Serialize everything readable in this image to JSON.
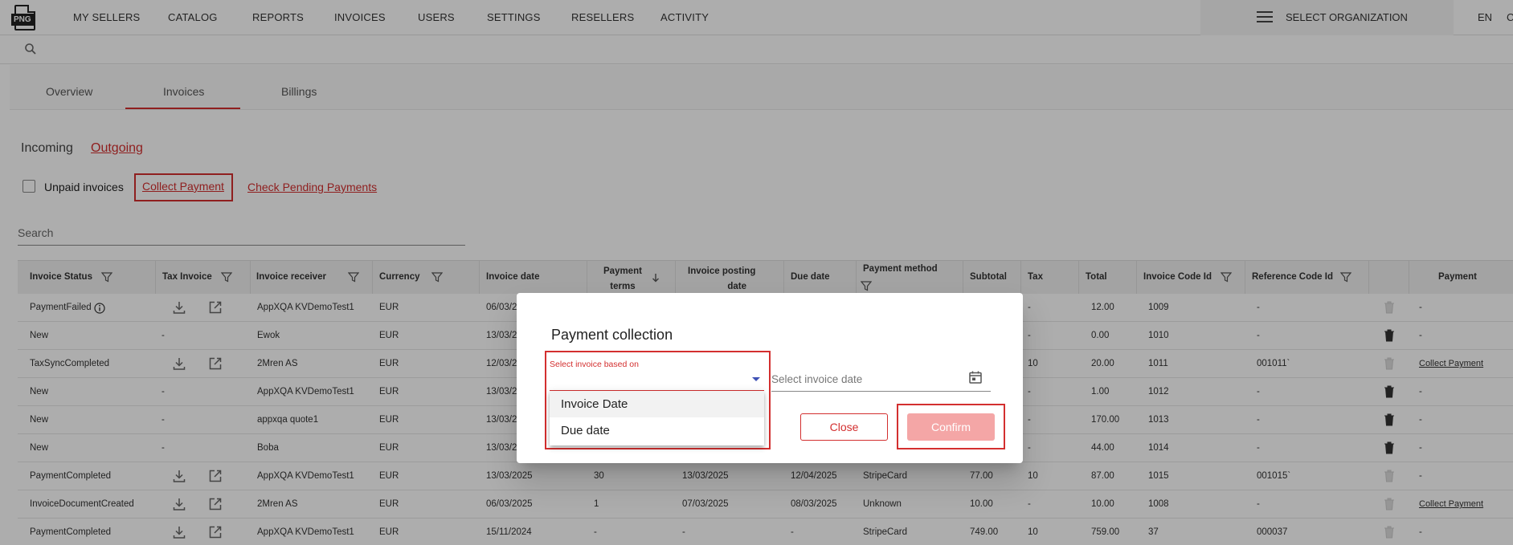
{
  "app": {
    "logo_text": "PNG"
  },
  "nav": {
    "items": [
      "MY SELLERS",
      "CATALOG",
      "REPORTS",
      "INVOICES",
      "USERS",
      "SETTINGS",
      "RESELLERS",
      "ACTIVITY"
    ],
    "organization_label": "SELECT ORGANIZATION",
    "language": "EN",
    "overflow_char": "C"
  },
  "tabs": [
    "Overview",
    "Invoices",
    "Billings"
  ],
  "subtabs": {
    "incoming": "Incoming",
    "outgoing": "Outgoing"
  },
  "filters": {
    "unpaid_label": "Unpaid invoices",
    "collect_payment": "Collect Payment",
    "check_pending": "Check Pending Payments",
    "search_placeholder": "Search"
  },
  "table": {
    "headers": {
      "invoice_status": "Invoice Status",
      "tax_invoice": "Tax Invoice",
      "invoice_receiver": "Invoice receiver",
      "currency": "Currency",
      "invoice_date": "Invoice date",
      "payment_terms_1": "Payment",
      "payment_terms_2": "terms",
      "posting_date_1": "Invoice posting",
      "posting_date_2": "date",
      "due_date": "Due date",
      "payment_method": "Payment method",
      "subtotal": "Subtotal",
      "tax": "Tax",
      "total": "Total",
      "invoice_code_id": "Invoice Code Id",
      "reference_code_id": "Reference Code Id",
      "payment": "Payment"
    },
    "rows": [
      {
        "status": "PaymentFailed",
        "receiver": "AppXQA KVDemoTest1",
        "currency": "EUR",
        "invoice_date": "06/03/20",
        "terms": "",
        "posting": "",
        "due": "",
        "method": "",
        "subtotal": "",
        "tax": "-",
        "total": "12.00",
        "code": "1009",
        "ref": "-",
        "payment": "-"
      },
      {
        "status": "New",
        "tax_invoice": "-",
        "receiver": "Ewok",
        "currency": "EUR",
        "invoice_date": "13/03/20",
        "terms": "",
        "posting": "",
        "due": "",
        "method": "",
        "subtotal": "",
        "tax": "-",
        "total": "0.00",
        "code": "1010",
        "ref": "-",
        "payment": "-"
      },
      {
        "status": "TaxSyncCompleted",
        "receiver": "2Mren AS",
        "currency": "EUR",
        "invoice_date": "12/03/20",
        "terms": "",
        "posting": "",
        "due": "",
        "method": "",
        "subtotal": "",
        "tax": "10",
        "total": "20.00",
        "code": "1011",
        "ref": "001011`",
        "payment": "Collect Payment"
      },
      {
        "status": "New",
        "tax_invoice": "-",
        "receiver": "AppXQA KVDemoTest1",
        "currency": "EUR",
        "invoice_date": "13/03/20",
        "terms": "",
        "posting": "",
        "due": "",
        "method": "",
        "subtotal": "",
        "tax": "-",
        "total": "1.00",
        "code": "1012",
        "ref": "-",
        "payment": "-"
      },
      {
        "status": "New",
        "tax_invoice": "-",
        "receiver": "appxqa quote1",
        "currency": "EUR",
        "invoice_date": "13/03/20",
        "terms": "",
        "posting": "",
        "due": "",
        "method": "",
        "subtotal": "",
        "tax": "-",
        "total": "170.00",
        "code": "1013",
        "ref": "-",
        "payment": "-"
      },
      {
        "status": "New",
        "tax_invoice": "-",
        "receiver": "Boba",
        "currency": "EUR",
        "invoice_date": "13/03/20",
        "terms": "",
        "posting": "",
        "due": "",
        "method": "",
        "subtotal": "",
        "tax": "-",
        "total": "44.00",
        "code": "1014",
        "ref": "-",
        "payment": "-"
      },
      {
        "status": "PaymentCompleted",
        "receiver": "AppXQA KVDemoTest1",
        "currency": "EUR",
        "invoice_date": "13/03/2025",
        "terms": "30",
        "posting": "13/03/2025",
        "due": "12/04/2025",
        "method": "StripeCard",
        "subtotal": "77.00",
        "tax": "10",
        "total": "87.00",
        "code": "1015",
        "ref": "001015`",
        "payment": "-"
      },
      {
        "status": "InvoiceDocumentCreated",
        "receiver": "2Mren AS",
        "currency": "EUR",
        "invoice_date": "06/03/2025",
        "terms": "1",
        "posting": "07/03/2025",
        "due": "08/03/2025",
        "method": "Unknown",
        "subtotal": "10.00",
        "tax": "-",
        "total": "10.00",
        "code": "1008",
        "ref": "-",
        "payment": "Collect Payment"
      },
      {
        "status": "PaymentCompleted",
        "receiver": "AppXQA KVDemoTest1",
        "currency": "EUR",
        "invoice_date": "15/11/2024",
        "terms": "-",
        "posting": "-",
        "due": "-",
        "method": "StripeCard",
        "subtotal": "749.00",
        "tax": "10",
        "total": "759.00",
        "code": "37",
        "ref": "000037",
        "payment": "-"
      }
    ]
  },
  "dialog": {
    "title": "Payment collection",
    "select_label": "Select invoice based on",
    "options": [
      "Invoice Date",
      "Due date"
    ],
    "date_placeholder": "Select invoice date",
    "close_label": "Close",
    "confirm_label": "Confirm"
  },
  "colors": {
    "accent": "#d32f2f",
    "confirm_disabled": "#f4a6a6"
  }
}
